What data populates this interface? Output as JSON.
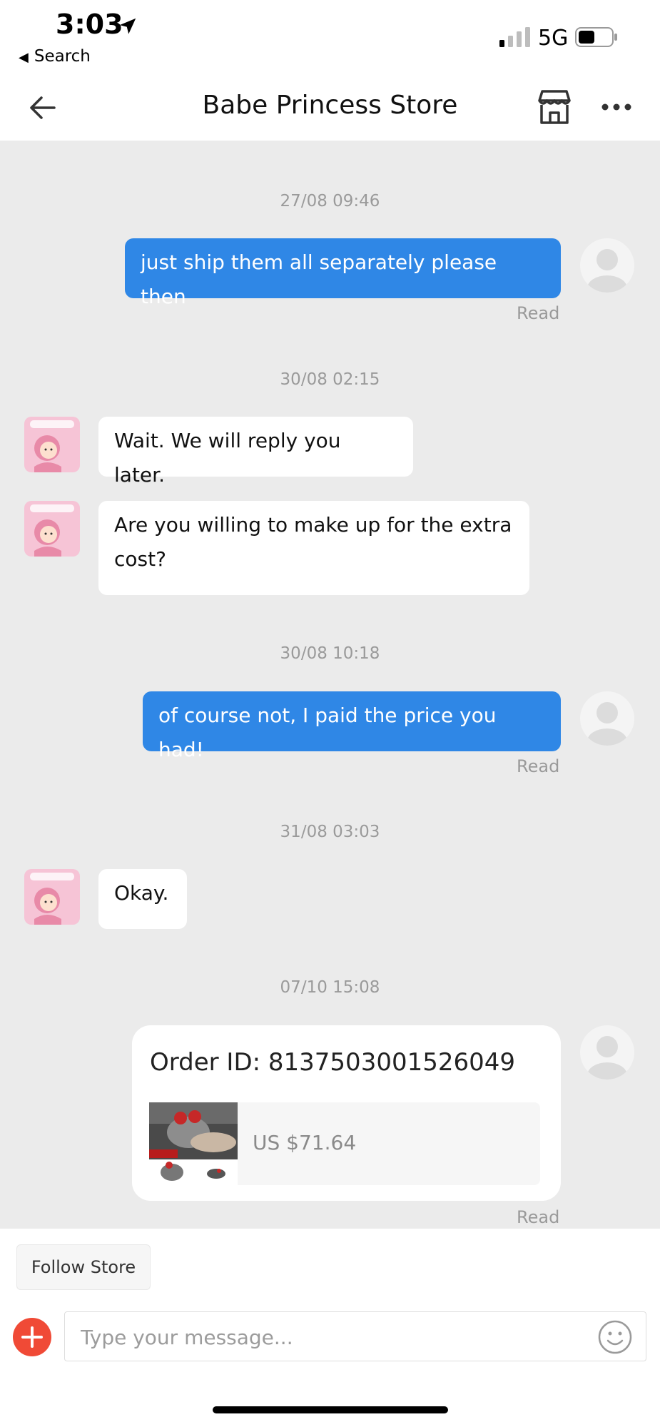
{
  "status_bar": {
    "time": "3:03",
    "back_app": "Search",
    "network": "5G"
  },
  "header": {
    "title": "Babe Princess Store",
    "icons": [
      "back-arrow-icon",
      "store-icon",
      "more-icon"
    ]
  },
  "messages": [
    {
      "timestamp": "27/08 09:46"
    },
    {
      "sender": "user",
      "text": "just ship them all separately please then",
      "status": "Read"
    },
    {
      "timestamp": "30/08 02:15"
    },
    {
      "sender": "store",
      "text": "Wait. We will reply you later."
    },
    {
      "sender": "store",
      "text": "Are you willing to make up for the extra cost?"
    },
    {
      "timestamp": "30/08 10:18"
    },
    {
      "sender": "user",
      "text": "of course not, I paid the price you had!",
      "status": "Read"
    },
    {
      "timestamp": "31/08 03:03"
    },
    {
      "sender": "store",
      "text": "Okay."
    },
    {
      "timestamp": "07/10 15:08"
    },
    {
      "sender": "user",
      "type": "order",
      "order_id": "Order ID: 8137503001526049",
      "price": "US $71.64",
      "status": "Read"
    }
  ],
  "bottom": {
    "follow_label": "Follow Store",
    "input_placeholder": "Type your message...",
    "input_value": ""
  },
  "colors": {
    "outgoing_bubble": "#2f87e6",
    "chat_background": "#ebebeb",
    "add_button": "#f04a36"
  }
}
